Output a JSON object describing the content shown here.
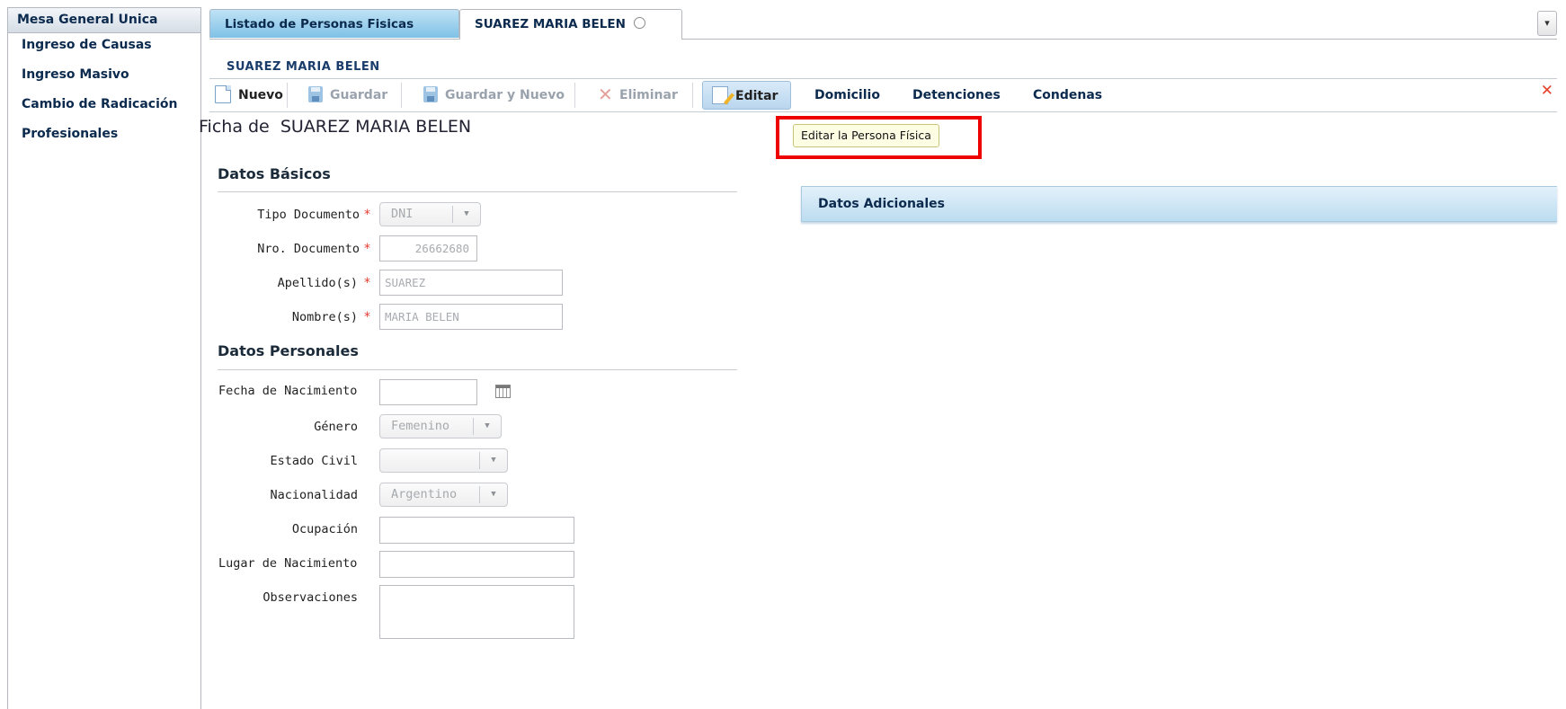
{
  "sidebar": {
    "header": "Mesa General Unica",
    "items": [
      {
        "label": "Ingreso de Causas"
      },
      {
        "label": "Ingreso Masivo"
      },
      {
        "label": "Cambio de Radicación"
      },
      {
        "label": "Profesionales"
      }
    ]
  },
  "tabs": {
    "list_tab": "Listado de Personas Fisicas",
    "active_tab": "SUAREZ MARIA BELEN",
    "menu_icon": "▾"
  },
  "panel": {
    "title": "SUAREZ MARIA BELEN"
  },
  "toolbar": {
    "nuevo": "Nuevo",
    "guardar": "Guardar",
    "guardar_nuevo": "Guardar y Nuevo",
    "eliminar": "Eliminar",
    "editar": "Editar",
    "domicilio": "Domicilio",
    "detenciones": "Detenciones",
    "condenas": "Condenas",
    "close": "✕"
  },
  "tooltip": "Editar la Persona Física",
  "ficha": {
    "prefix": "Ficha de",
    "name": "SUAREZ MARIA BELEN"
  },
  "datos_basicos": {
    "title": "Datos Básicos",
    "tipo_documento": {
      "label": "Tipo Documento",
      "value": "DNI"
    },
    "nro_documento": {
      "label": "Nro. Documento",
      "value": "26662680"
    },
    "apellidos": {
      "label": "Apellido(s)",
      "value": "SUAREZ"
    },
    "nombres": {
      "label": "Nombre(s)",
      "value": "MARIA BELEN"
    },
    "required_mark": "*"
  },
  "datos_personales": {
    "title": "Datos Personales",
    "fecha_nacimiento": {
      "label": "Fecha de Nacimiento",
      "value": ""
    },
    "genero": {
      "label": "Género",
      "value": "Femenino"
    },
    "estado_civil": {
      "label": "Estado Civil",
      "value": ""
    },
    "nacionalidad": {
      "label": "Nacionalidad",
      "value": "Argentino"
    },
    "ocupacion": {
      "label": "Ocupación",
      "value": ""
    },
    "lugar_nacimiento": {
      "label": "Lugar de Nacimiento",
      "value": ""
    },
    "observaciones": {
      "label": "Observaciones",
      "value": ""
    }
  },
  "adicionales": {
    "title": "Datos Adicionales"
  },
  "colors": {
    "highlight_box": "#ee0000",
    "tab_active_bg": "#7fc1e6",
    "required": "#e53b2f"
  }
}
